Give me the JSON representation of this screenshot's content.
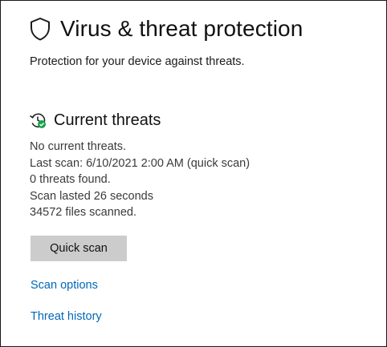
{
  "page": {
    "title": "Virus & threat protection",
    "subtitle": "Protection for your device against threats."
  },
  "current_threats": {
    "title": "Current threats",
    "lines": [
      "No current threats.",
      "Last scan: 6/10/2021 2:00 AM (quick scan)",
      "0 threats found.",
      "Scan lasted 26 seconds",
      "34572 files scanned."
    ]
  },
  "actions": {
    "quick_scan_label": "Quick scan",
    "scan_options_label": "Scan options",
    "threat_history_label": "Threat history"
  },
  "icons": {
    "header_icon": "shield-icon",
    "section_icon": "clock-refresh-check-icon"
  },
  "colors": {
    "link": "#0067b8",
    "button_bg": "#cccccc",
    "status_check": "#16a34a"
  }
}
